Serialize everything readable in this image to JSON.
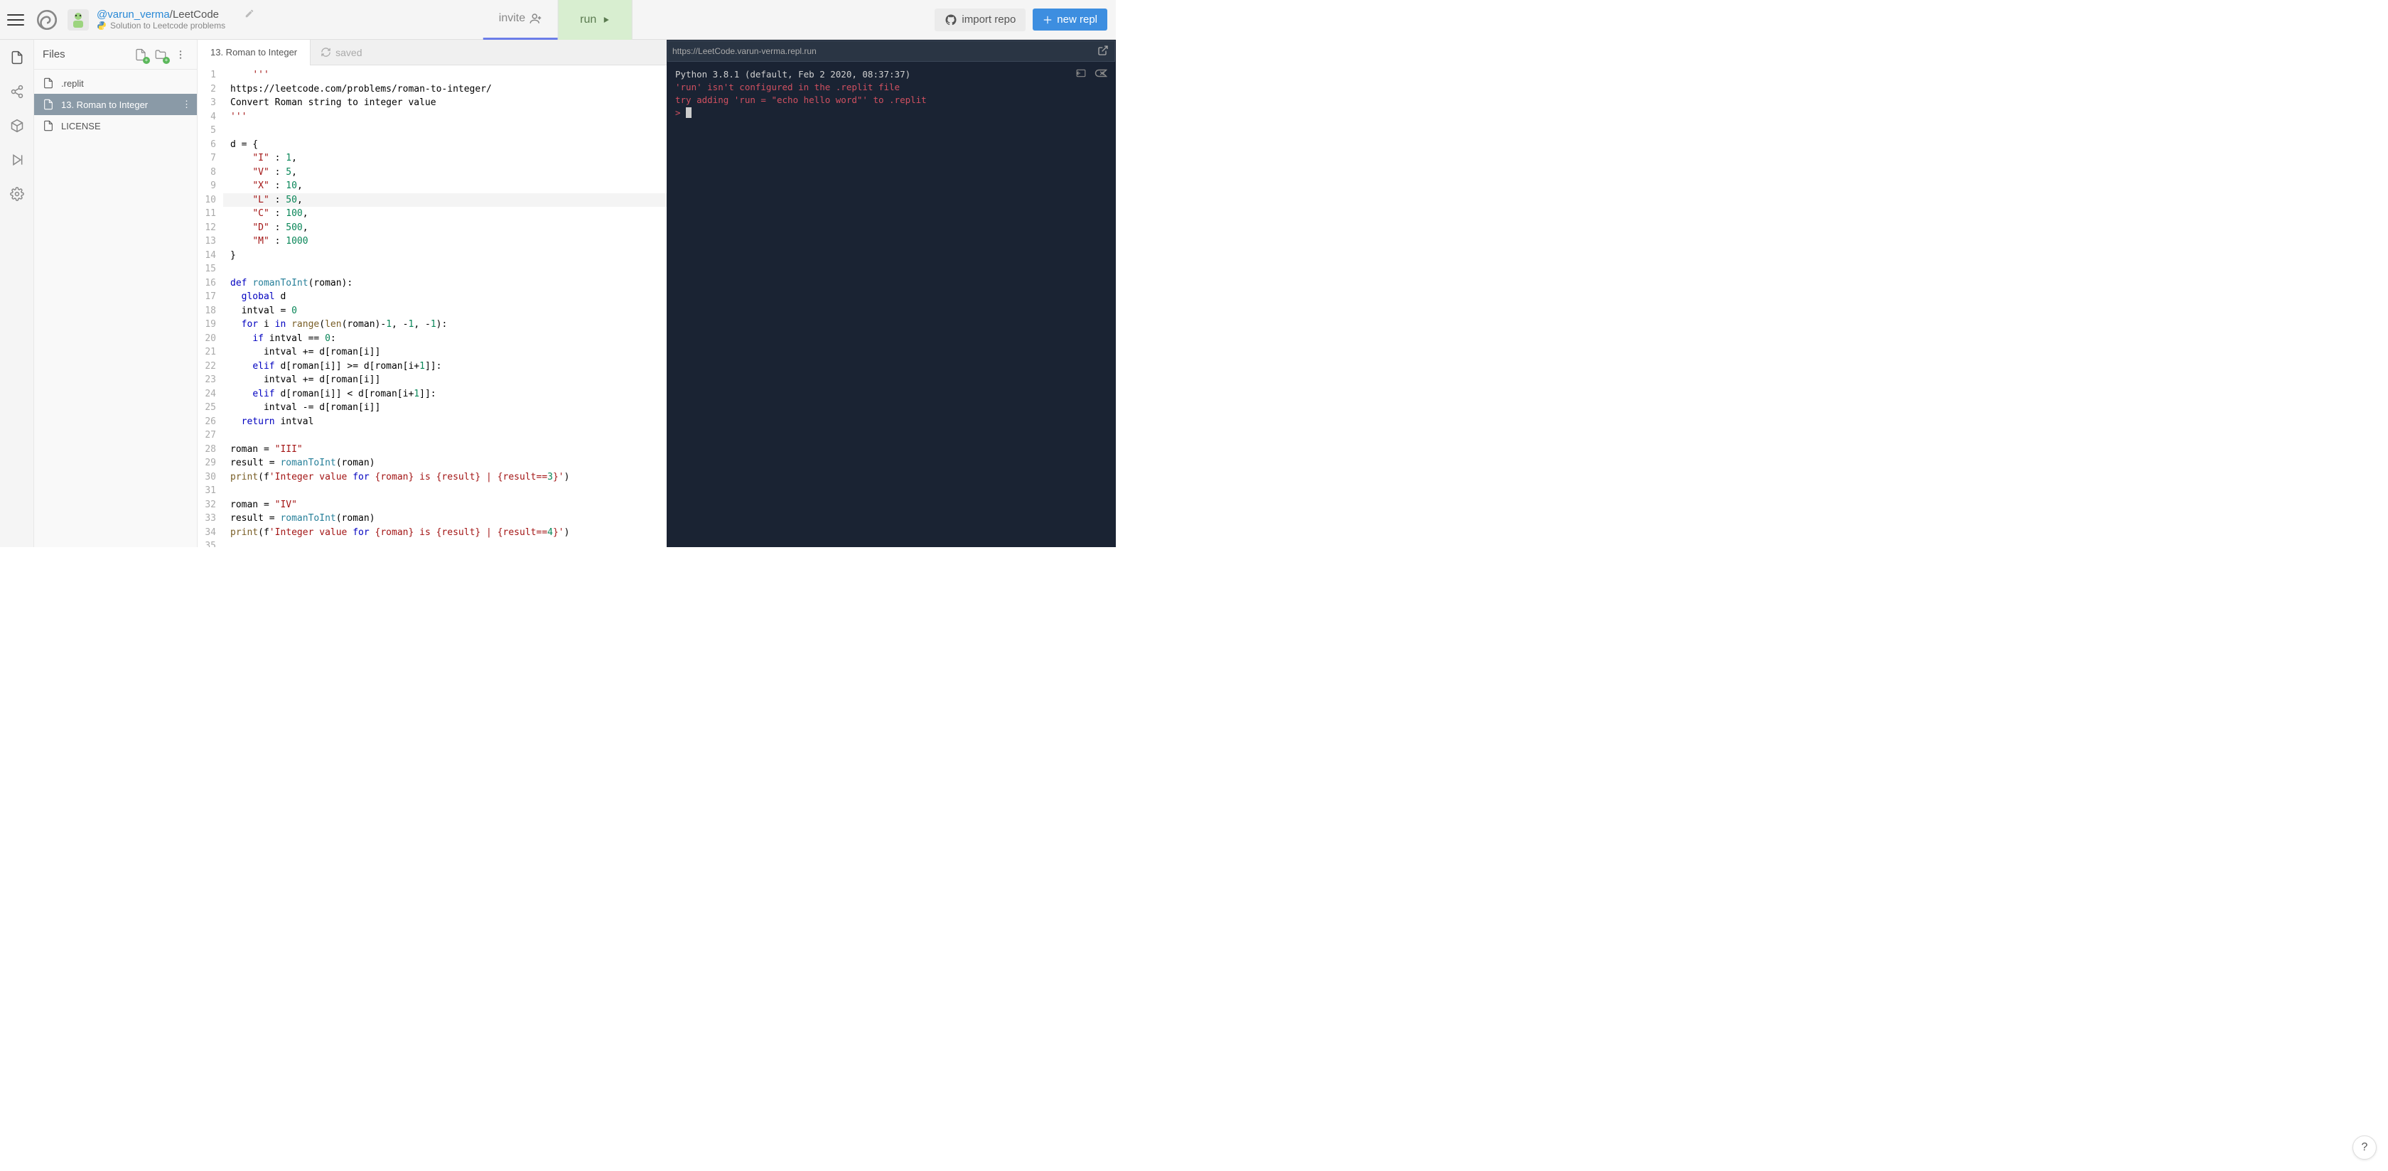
{
  "header": {
    "user": "@varun_verma",
    "repo": "/LeetCode",
    "subtitle": "Solution to Leetcode problems",
    "invite_label": "invite",
    "run_label": "run",
    "import_label": "import repo",
    "new_repl_label": "new repl"
  },
  "sidebar_rail": [
    "files",
    "share",
    "packages",
    "debugger",
    "settings"
  ],
  "files_panel": {
    "title": "Files",
    "items": [
      {
        "name": ".replit",
        "selected": false
      },
      {
        "name": "13. Roman to Integer",
        "selected": true
      },
      {
        "name": "LICENSE",
        "selected": false
      }
    ]
  },
  "editor": {
    "tab_label": "13. Roman to Integer",
    "saved_label": "saved",
    "highlighted_line": 10,
    "lines": [
      "    '''",
      "https://leetcode.com/problems/roman-to-integer/",
      "Convert Roman string to integer value",
      "'''",
      "",
      "d = {",
      "    \"I\" : 1,",
      "    \"V\" : 5,",
      "    \"X\" : 10,",
      "    \"L\" : 50,",
      "    \"C\" : 100,",
      "    \"D\" : 500,",
      "    \"M\" : 1000",
      "}",
      "",
      "def romanToInt(roman):",
      "  global d",
      "  intval = 0",
      "  for i in range(len(roman)-1, -1, -1):",
      "    if intval == 0:",
      "      intval += d[roman[i]]",
      "    elif d[roman[i]] >= d[roman[i+1]]:",
      "      intval += d[roman[i]]",
      "    elif d[roman[i]] < d[roman[i+1]]:",
      "      intval -= d[roman[i]]",
      "  return intval",
      "",
      "roman = \"III\"",
      "result = romanToInt(roman)",
      "print(f'Integer value for {roman} is {result} | {result==3}')",
      "",
      "roman = \"IV\"",
      "result = romanToInt(roman)",
      "print(f'Integer value for {roman} is {result} | {result==4}')",
      ""
    ]
  },
  "console": {
    "url": "https://LeetCode.varun-verma.repl.run",
    "lines": [
      {
        "text": "Python 3.8.1 (default, Feb  2 2020, 08:37:37)",
        "cls": "white"
      },
      {
        "text": "'run' isn't configured in the .replit file",
        "cls": "red"
      },
      {
        "text": "try adding 'run = \"echo hello word\"' to .replit",
        "cls": "red"
      }
    ],
    "prompt": ">"
  },
  "help_label": "?"
}
